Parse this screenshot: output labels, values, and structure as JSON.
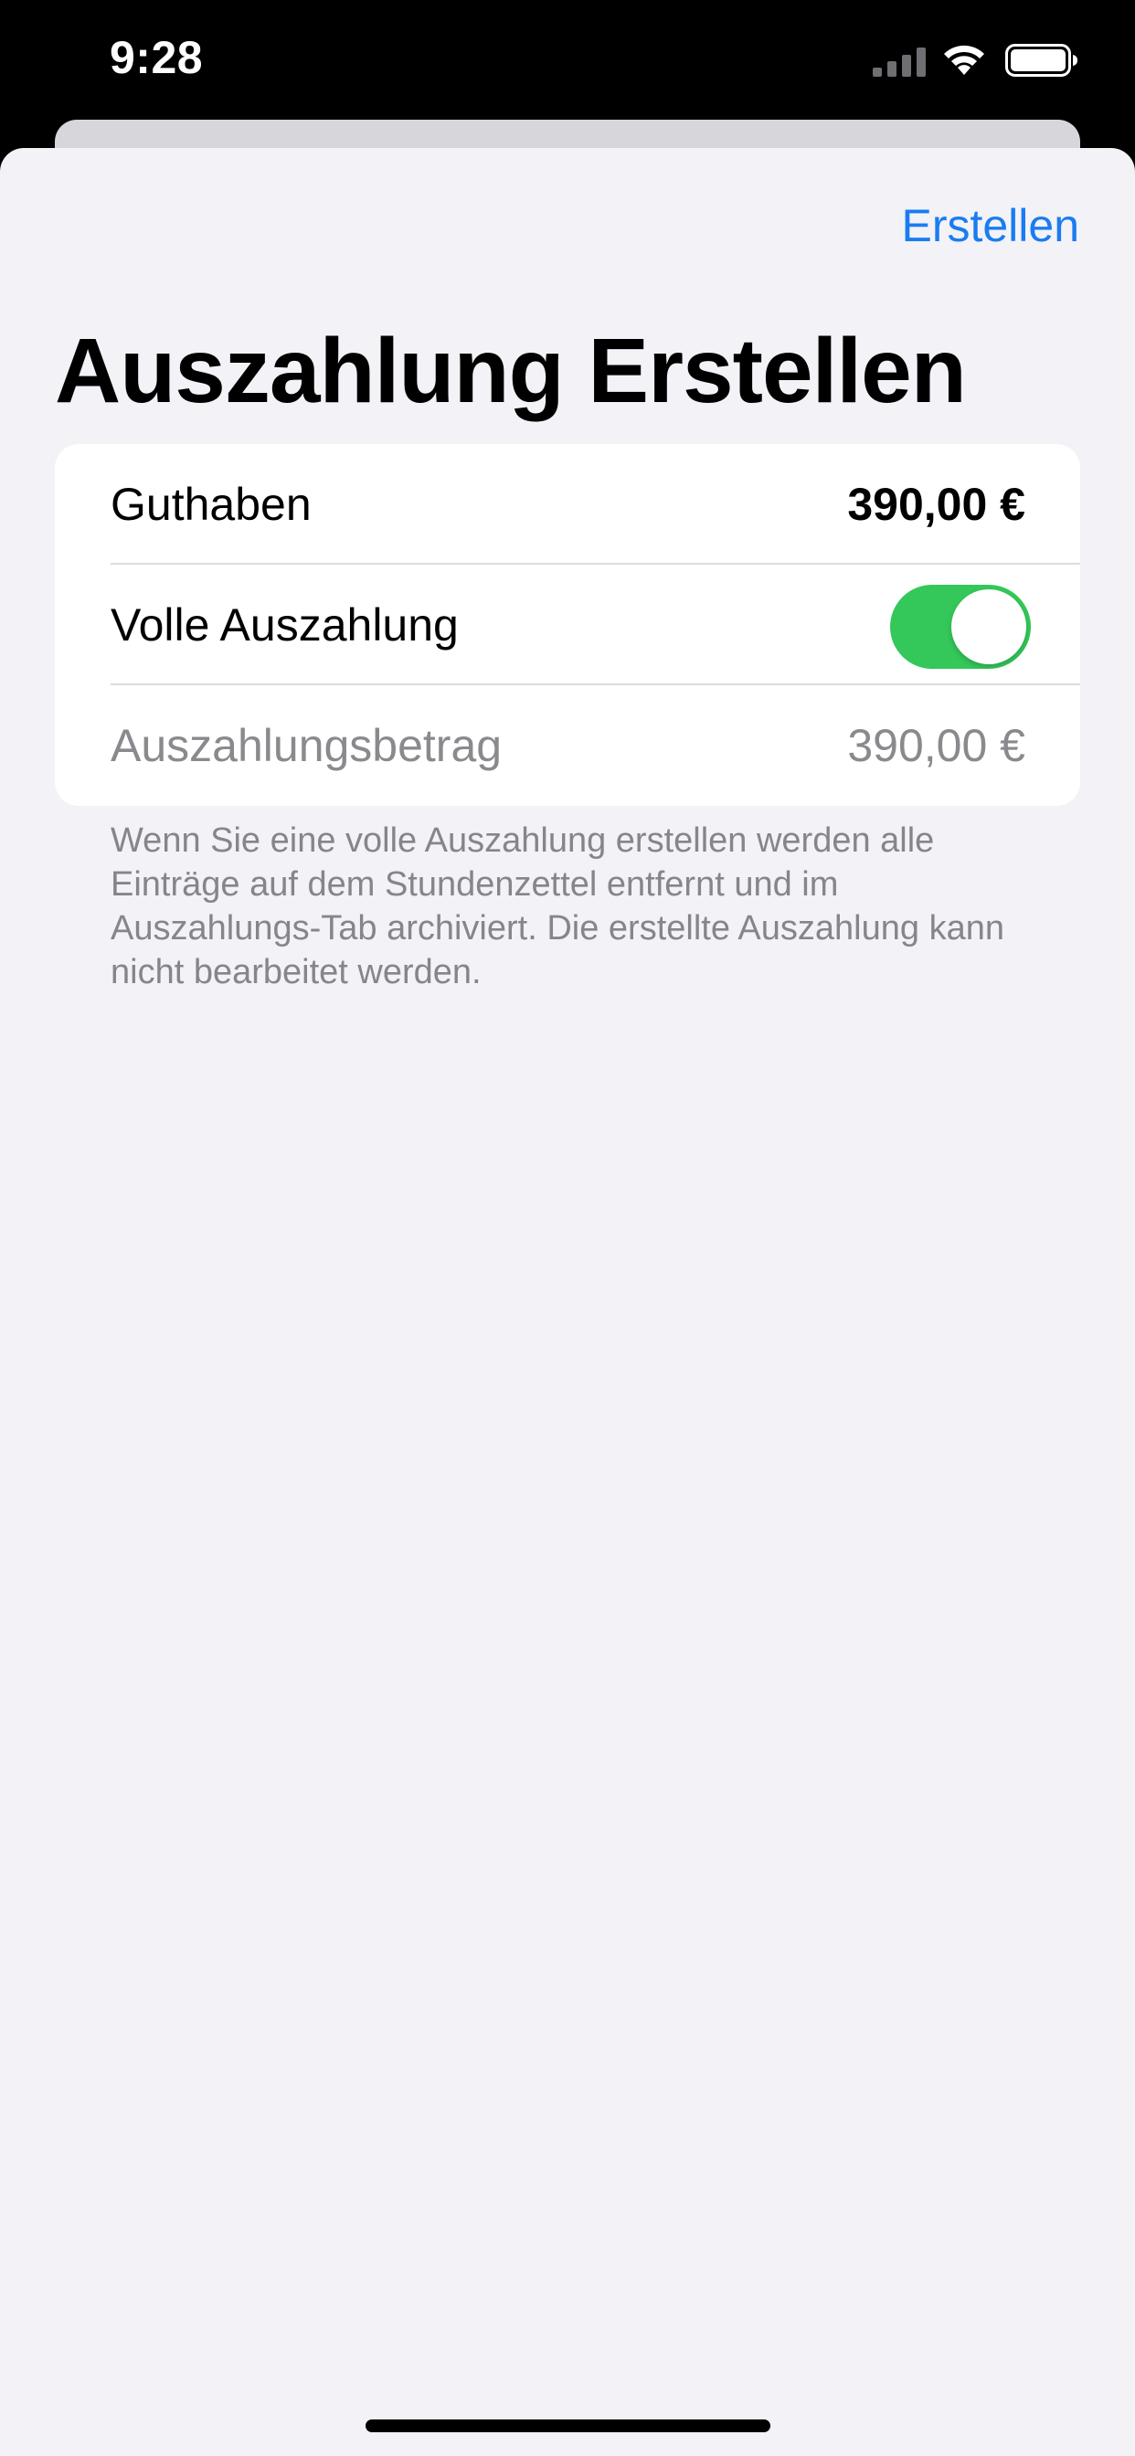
{
  "status_bar": {
    "time": "9:28",
    "icons": [
      "cellular-signal-icon",
      "wifi-icon",
      "battery-icon"
    ]
  },
  "sheet": {
    "nav_action_label": "Erstellen",
    "title": "Auszahlung Erstellen",
    "rows": [
      {
        "label": "Guthaben",
        "value": "390,00 €"
      },
      {
        "label": "Volle Auszahlung",
        "toggle_on": true
      },
      {
        "label": "Auszahlungsbetrag",
        "value": "390,00 €"
      }
    ],
    "footer_note": "Wenn Sie eine volle Auszahlung erstellen werden alle Einträge auf dem Stundenzettel entfernt und im Auszahlungs-Tab archiviert. Die erstellte Auszahlung kann nicht bearbeitet werden."
  },
  "colors": {
    "accent": "#1a7cf0",
    "toggle_on": "#34c759",
    "sheet_background": "#f2f2f7",
    "secondary_text": "#8a8a8e"
  }
}
